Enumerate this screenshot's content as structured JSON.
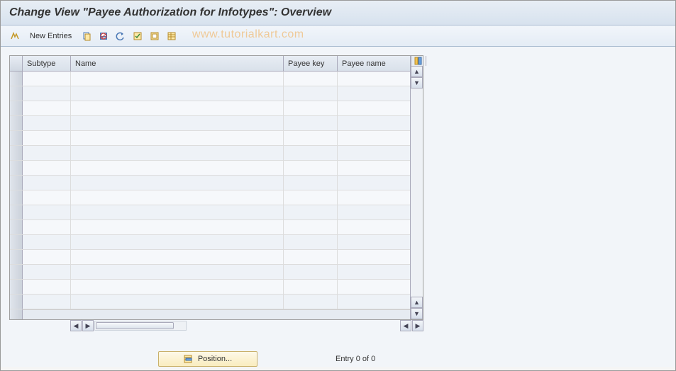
{
  "title": "Change View \"Payee Authorization for Infotypes\": Overview",
  "toolbar": {
    "new_entries_label": "New Entries"
  },
  "watermark": "www.tutorialkart.com",
  "table": {
    "columns": {
      "subtype": "Subtype",
      "name": "Name",
      "payee_key": "Payee key",
      "payee_name": "Payee name"
    },
    "row_count": 16
  },
  "footer": {
    "position_label": "Position...",
    "entry_text": "Entry 0 of 0"
  }
}
